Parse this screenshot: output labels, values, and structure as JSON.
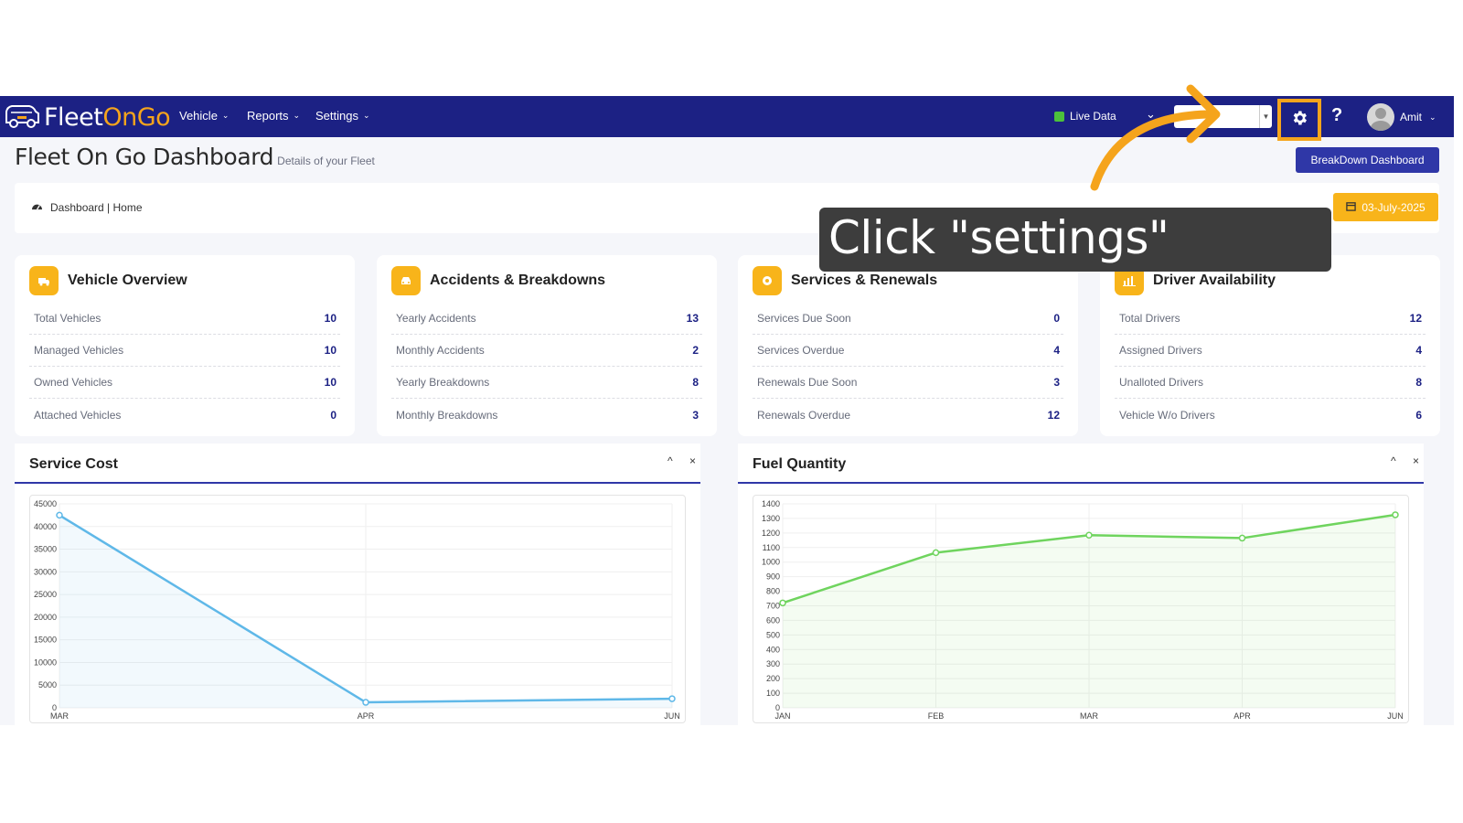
{
  "nav": {
    "logo": {
      "part1": "Fleet",
      "part2": "OnGo"
    },
    "menus": [
      {
        "label": "Vehicle"
      },
      {
        "label": "Reports"
      },
      {
        "label": "Settings"
      }
    ],
    "live_data_label": "Live Data",
    "user_name": "Amit"
  },
  "header": {
    "title": "Fleet On Go Dashboard",
    "subtitle": "Details of your Fleet",
    "breakdown_button": "BreakDown Dashboard"
  },
  "breadcrumb": {
    "text": "Dashboard | Home",
    "date": "03-July-2025"
  },
  "cards": [
    {
      "title": "Vehicle Overview",
      "rows": [
        {
          "label": "Total Vehicles",
          "value": "10"
        },
        {
          "label": "Managed Vehicles",
          "value": "10"
        },
        {
          "label": "Owned Vehicles",
          "value": "10"
        },
        {
          "label": "Attached Vehicles",
          "value": "0"
        }
      ]
    },
    {
      "title": "Accidents & Breakdowns",
      "rows": [
        {
          "label": "Yearly Accidents",
          "value": "13"
        },
        {
          "label": "Monthly Accidents",
          "value": "2"
        },
        {
          "label": "Yearly Breakdowns",
          "value": "8"
        },
        {
          "label": "Monthly Breakdowns",
          "value": "3"
        }
      ]
    },
    {
      "title": "Services & Renewals",
      "rows": [
        {
          "label": "Services Due Soon",
          "value": "0"
        },
        {
          "label": "Services Overdue",
          "value": "4"
        },
        {
          "label": "Renewals Due Soon",
          "value": "3"
        },
        {
          "label": "Renewals Overdue",
          "value": "12"
        }
      ]
    },
    {
      "title": "Driver Availability",
      "rows": [
        {
          "label": "Total Drivers",
          "value": "12"
        },
        {
          "label": "Assigned Drivers",
          "value": "4"
        },
        {
          "label": "Unalloted Drivers",
          "value": "8"
        },
        {
          "label": "Vehicle W/o Drivers",
          "value": "6"
        }
      ]
    }
  ],
  "panels": [
    {
      "title": "Service Cost",
      "collapse": "^",
      "close": "×"
    },
    {
      "title": "Fuel Quantity",
      "collapse": "^",
      "close": "×"
    }
  ],
  "tooltip": "Click \"settings\"",
  "colors": {
    "nav": "#1c2184",
    "accent": "#f5a41c",
    "button": "#2f37a7",
    "service_line": "#5fb8e8",
    "fuel_line": "#6fd45e"
  },
  "chart_data": [
    {
      "type": "line",
      "title": "Service Cost",
      "categories": [
        "MAR",
        "APR",
        "JUN"
      ],
      "series": [
        {
          "values": [
            42500,
            1200,
            2000
          ]
        }
      ],
      "ylim": [
        0,
        45000
      ],
      "yticks": [
        0,
        5000,
        10000,
        15000,
        20000,
        25000,
        30000,
        35000,
        40000,
        45000
      ],
      "grid": true
    },
    {
      "type": "line",
      "title": "Fuel Quantity",
      "categories": [
        "JAN",
        "FEB",
        "MAR",
        "APR",
        "JUN"
      ],
      "series": [
        {
          "values": [
            720,
            1065,
            1185,
            1165,
            1325
          ]
        }
      ],
      "ylim": [
        0,
        1400
      ],
      "yticks": [
        0,
        100,
        200,
        300,
        400,
        500,
        600,
        700,
        800,
        900,
        1000,
        1100,
        1200,
        1300,
        1400
      ],
      "grid": true
    }
  ]
}
